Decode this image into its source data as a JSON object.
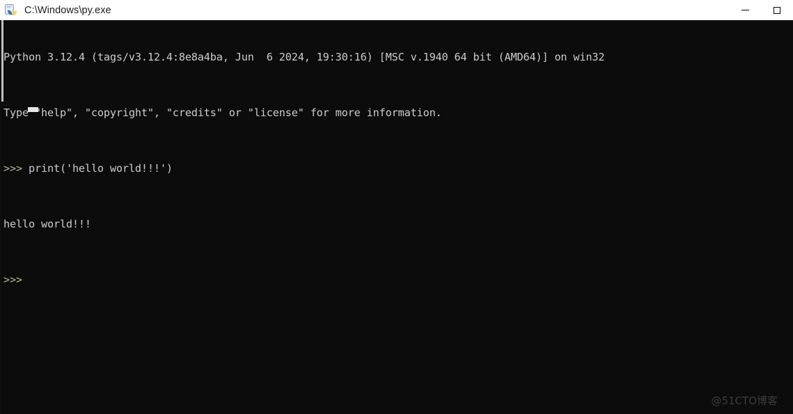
{
  "window": {
    "title": "C:\\Windows\\py.exe",
    "icon": "python-launcher-icon",
    "background_color": "#0c0c0c",
    "titlebar_color": "#ffffff"
  },
  "titlebar": {
    "minimize_label": "—",
    "maximize_label": "☐",
    "minimize_name": "minimize-button",
    "maximize_name": "maximize-button"
  },
  "console": {
    "text_color": "#ccccd0",
    "prompt_color": "#b9b39a",
    "lines": [
      {
        "id": "banner-version",
        "text": "Python 3.12.4 (tags/v3.12.4:8e8a4ba, Jun  6 2024, 19:30:16) [MSC v.1940 64 bit (AMD64)] on win32"
      },
      {
        "id": "banner-help",
        "text": "Type \"help\", \"copyright\", \"credits\" or \"license\" for more information."
      },
      {
        "id": "input-print",
        "prompt": ">>> ",
        "text": "print('hello world!!!')"
      },
      {
        "id": "output-hello",
        "text": "hello world!!!"
      },
      {
        "id": "input-empty",
        "prompt": ">>> ",
        "text": ""
      }
    ]
  },
  "watermark": {
    "text": "@51CTO博客"
  }
}
